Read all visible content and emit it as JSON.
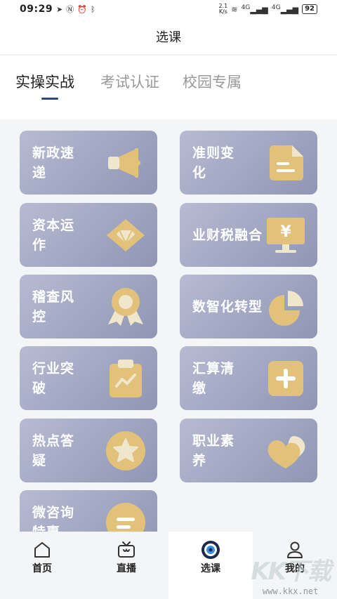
{
  "status_bar": {
    "time": "09:29",
    "net_speed_value": "2.1",
    "net_speed_unit": "K/s",
    "sig_label": "4G",
    "battery": "92"
  },
  "header": {
    "title": "选课"
  },
  "tabs": [
    {
      "label": "实操实战",
      "active": true
    },
    {
      "label": "考试认证",
      "active": false
    },
    {
      "label": "校园专属",
      "active": false
    }
  ],
  "cards": [
    {
      "label": "新政速递",
      "icon": "megaphone-icon"
    },
    {
      "label": "准则变化",
      "icon": "document-icon"
    },
    {
      "label": "资本运作",
      "icon": "diamond-icon"
    },
    {
      "label": "业财税融合",
      "icon": "yuan-monitor-icon"
    },
    {
      "label": "稽查风控",
      "icon": "medal-icon"
    },
    {
      "label": "数智化转型",
      "icon": "pie-chart-icon"
    },
    {
      "label": "行业突破",
      "icon": "clipboard-chart-icon"
    },
    {
      "label": "汇算清缴",
      "icon": "plus-icon"
    },
    {
      "label": "热点答疑",
      "icon": "star-icon"
    },
    {
      "label": "职业素养",
      "icon": "heart-icon"
    },
    {
      "label": "微咨询特惠",
      "icon": "message-icon"
    }
  ],
  "nav": [
    {
      "label": "首页",
      "icon": "home-icon",
      "active": false
    },
    {
      "label": "直播",
      "icon": "tv-icon",
      "active": false
    },
    {
      "label": "选课",
      "icon": "eye-icon",
      "active": true
    },
    {
      "label": "我的",
      "icon": "user-icon",
      "active": false
    }
  ],
  "watermark": {
    "big": "KK下载",
    "small": "www.kkx.net"
  },
  "colors": {
    "card_start": "#b7bad2",
    "card_end": "#8f96b4",
    "icon_gold": "#e2c27a",
    "icon_light": "#f0e6cc",
    "indicator": "#2f4778"
  }
}
